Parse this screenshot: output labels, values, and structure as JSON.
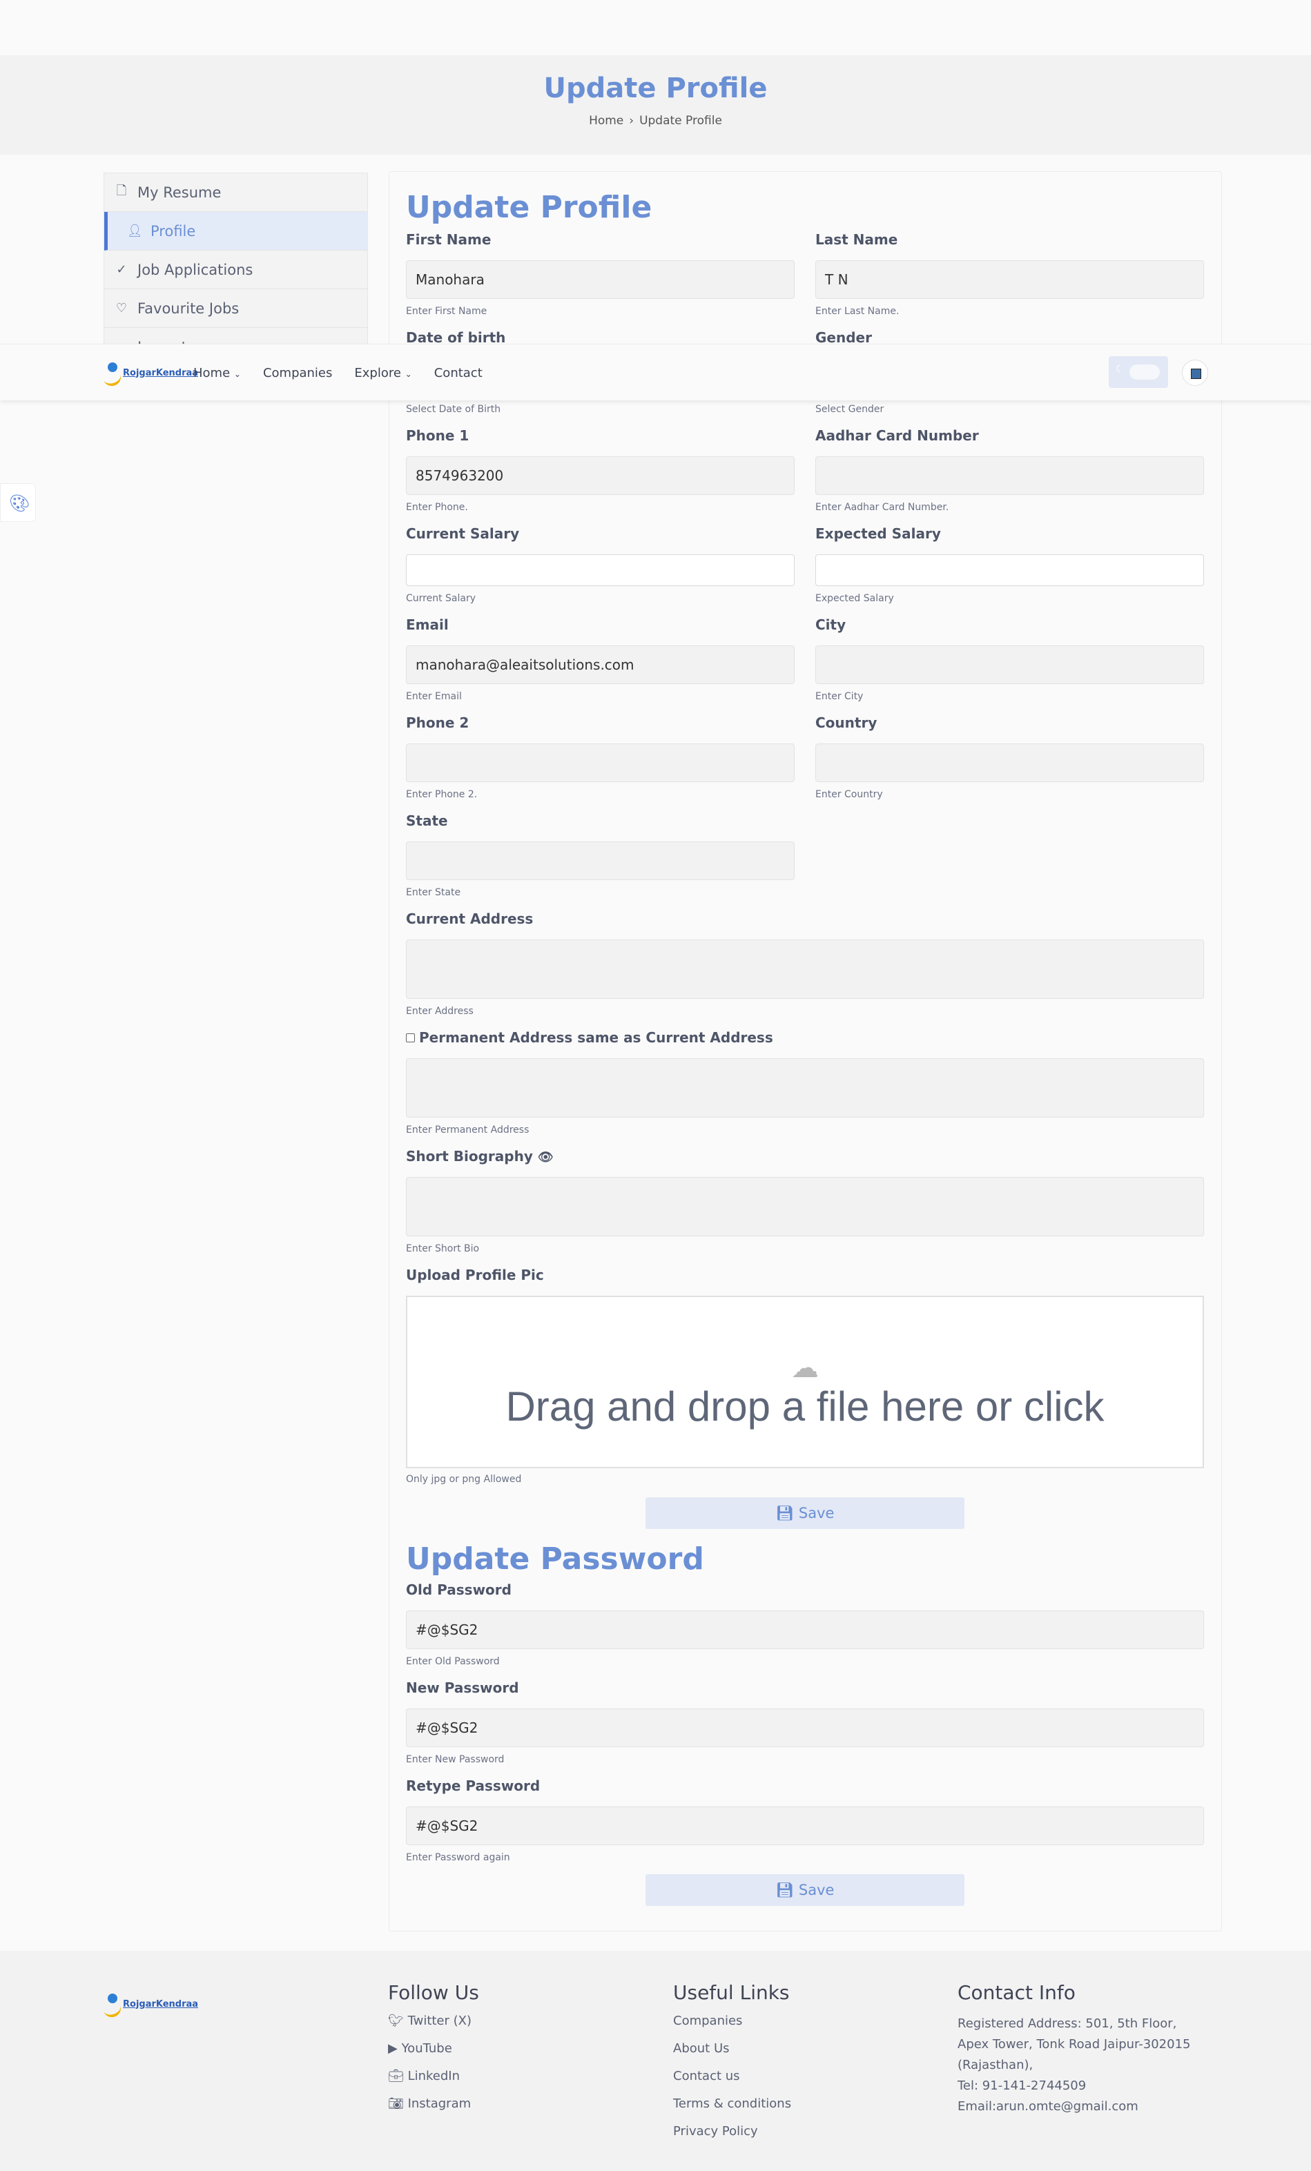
{
  "hero": {
    "title": "Update Profile",
    "crumb_home": "Home",
    "crumb_sep": "›",
    "crumb_current": "Update Profile"
  },
  "sidebar": {
    "items": [
      {
        "label": "My Resume",
        "icon": "file-icon"
      },
      {
        "label": "Profile",
        "icon": "user-icon"
      },
      {
        "label": "Job Applications",
        "icon": "check-icon"
      },
      {
        "label": "Favourite Jobs",
        "icon": "heart-icon"
      },
      {
        "label": "Logout",
        "icon": "logout-icon"
      }
    ]
  },
  "nav": {
    "brand": "RojgarKendraa",
    "home": "Home",
    "companies": "Companies",
    "explore": "Explore",
    "contact": "Contact"
  },
  "profile": {
    "heading": "Update Profile",
    "first_name": {
      "label": "First Name",
      "value": "Manohara",
      "hint": "Enter First Name"
    },
    "last_name": {
      "label": "Last Name",
      "value": "T N",
      "hint": "Enter Last Name."
    },
    "dob": {
      "label": "Date of birth",
      "hint": "Select Date of Birth"
    },
    "gender": {
      "label": "Gender",
      "hint": "Select Gender"
    },
    "phone1": {
      "label": "Phone 1",
      "value": "8574963200",
      "hint": "Enter Phone."
    },
    "aadhar": {
      "label": "Aadhar Card Number",
      "value": "",
      "hint": "Enter Aadhar Card Number."
    },
    "current_salary": {
      "label": "Current Salary",
      "value": "",
      "hint": "Current Salary"
    },
    "expected_salary": {
      "label": "Expected Salary",
      "value": "",
      "hint": "Expected Salary"
    },
    "email": {
      "label": "Email",
      "value": "manohara@aleaitsolutions.com",
      "hint": "Enter Email"
    },
    "city": {
      "label": "City",
      "value": "",
      "hint": "Enter City"
    },
    "phone2": {
      "label": "Phone 2",
      "value": "",
      "hint": "Enter Phone 2."
    },
    "country": {
      "label": "Country",
      "value": "",
      "hint": "Enter Country"
    },
    "state": {
      "label": "State",
      "value": "",
      "hint": "Enter State"
    },
    "current_address": {
      "label": "Current Address",
      "value": "",
      "hint": "Enter Address"
    },
    "permanent_same": {
      "label": "Permanent Address same as Current Address",
      "checked": false
    },
    "permanent_address": {
      "value": "",
      "hint": "Enter Permanent Address"
    },
    "short_bio": {
      "label": "Short Biography",
      "value": "",
      "hint": "Enter Short Bio"
    },
    "upload": {
      "label": "Upload Profile Pic",
      "drop_text": "Drag and drop a file here or click",
      "hint": "Only jpg or png Allowed"
    },
    "save_label": "Save"
  },
  "password": {
    "heading": "Update Password",
    "old": {
      "label": "Old Password",
      "value": "#@$SG2",
      "hint": "Enter Old Password"
    },
    "new": {
      "label": "New Password",
      "value": "#@$SG2",
      "hint": "Enter New Password"
    },
    "retype": {
      "label": "Retype Password",
      "value": "#@$SG2",
      "hint": "Enter Password again"
    },
    "save_label": "Save"
  },
  "footer": {
    "follow": {
      "title": "Follow Us",
      "items": [
        "Twitter (X)",
        "YouTube",
        "LinkedIn",
        "Instagram"
      ]
    },
    "links": {
      "title": "Useful Links",
      "items": [
        "Companies",
        "About Us",
        "Contact us",
        "Terms & conditions",
        "Privacy Policy"
      ]
    },
    "contact": {
      "title": "Contact Info",
      "address": "Registered Address: 501, 5th Floor, Apex Tower, Tonk Road Jaipur-302015 (Rajasthan),",
      "tel": "Tel: 91-141-2744509",
      "email": "Email:arun.omte@gmail.com"
    }
  },
  "colors": {
    "accent": "#6a8fd4",
    "active_bar": "#4a78d6",
    "button_bg": "#e2e8f5"
  }
}
